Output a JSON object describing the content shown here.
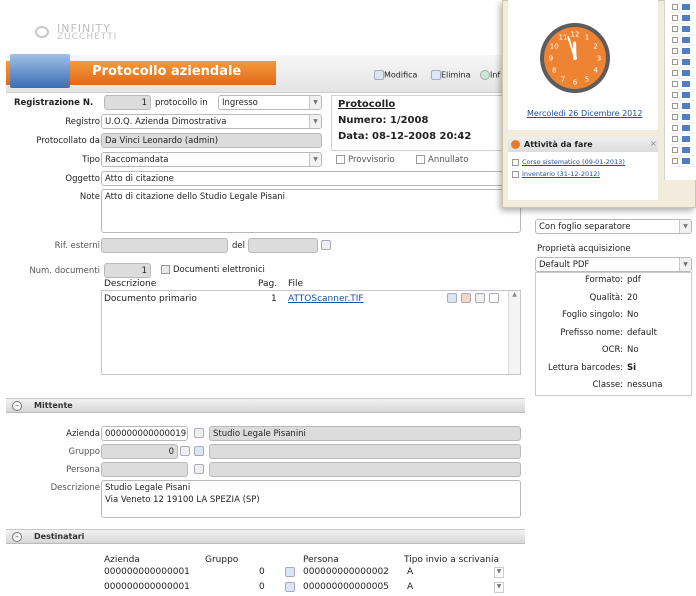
{
  "brand": {
    "logo_line1": "INFINITY",
    "logo_line2": "ZUCCHETTI"
  },
  "header": {
    "title": "Protocollo aziendale",
    "actions": [
      "Modifica",
      "Elimina",
      "Inf"
    ]
  },
  "form": {
    "reg_label": "Registrazione N.",
    "reg_value": "1",
    "prot_in_label": "protocollo in",
    "prot_in_value": "Ingresso",
    "registro_label": "Registro",
    "registro_value": "U.O.Q. Azienda Dimostrativa",
    "protocollato_label": "Protocollato da",
    "protocollato_value": "Da Vinci Leonardo (admin)",
    "tipo_label": "Tipo",
    "tipo_value": "Raccomandata",
    "provvisorio": "Provvisorio",
    "annullato": "Annullato",
    "oggetto_label": "Oggetto",
    "oggetto_value": "Atto di citazione",
    "note_label": "Note",
    "note_value": "Atto di citazione dello Studio Legale Pisani",
    "rif_label": "Rif. esterni",
    "del_label": "del",
    "num_doc_label": "Num. documenti",
    "num_doc_value": "1",
    "doc_elettronici": "Documenti elettronici"
  },
  "protocol_box": {
    "title": "Protocollo",
    "numero": "Numero: 1/2008",
    "data": "Data: 08-12-2008 20:42"
  },
  "documents": {
    "headers": [
      "Descrizione",
      "Pag.",
      "File"
    ],
    "rows": [
      {
        "descrizione": "Documento primario",
        "pag": "1",
        "file": "ATTOScanner.TIF"
      }
    ]
  },
  "mittente": {
    "title": "Mittente",
    "azienda_label": "Azienda",
    "azienda_code": "000000000000019",
    "azienda_name": "Studio Legale Pisanini",
    "gruppo_label": "Gruppo",
    "gruppo_value": "0",
    "persona_label": "Persona",
    "descr_label": "Descrizione",
    "descr_line1": "Studio Legale Pisani",
    "descr_line2": "Via Veneto 12 19100 LA SPEZIA (SP)"
  },
  "destinatari": {
    "title": "Destinatari",
    "headers": [
      "Azienda",
      "Gruppo",
      "Persona",
      "Tipo invio a scrivania"
    ],
    "rows": [
      {
        "azienda": "000000000000001",
        "gruppo": "0",
        "persona": "000000000000002",
        "tipo": "A"
      },
      {
        "azienda": "000000000000001",
        "gruppo": "0",
        "persona": "000000000000005",
        "tipo": "A"
      }
    ]
  },
  "acquisition": {
    "sep_value": "Con foglio separatore",
    "prop_label": "Proprietà acquisizione",
    "prop_value": "Default PDF",
    "props": [
      {
        "k": "Formato:",
        "v": "pdf"
      },
      {
        "k": "Qualità:",
        "v": "20"
      },
      {
        "k": "Foglio singolo:",
        "v": "No"
      },
      {
        "k": "Prefisso nome:",
        "v": "default"
      },
      {
        "k": "OCR:",
        "v": "No"
      },
      {
        "k": "Lettura barcodes:",
        "v": "Si"
      },
      {
        "k": "Classe:",
        "v": "nessuna"
      }
    ]
  },
  "widget": {
    "date": "Mercoledì 26 Dicembre 2012",
    "tasks_title": "Attività da fare",
    "tasks": [
      "Corso sistematico (09-01-2013)",
      "Inventario (31-12-2012)"
    ],
    "clock_numbers": [
      "12",
      "1",
      "2",
      "3",
      "4",
      "5",
      "6",
      "7",
      "8",
      "9",
      "10",
      "11"
    ],
    "clock_hour": 11.95,
    "clock_minute": 57
  }
}
